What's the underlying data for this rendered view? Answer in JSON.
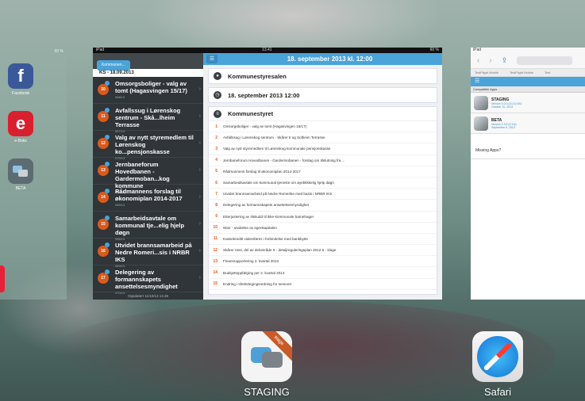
{
  "home_card": {
    "battery": "60 %",
    "apps": [
      {
        "label": "Facebook",
        "glyph": "f",
        "color": "#3b5998"
      },
      {
        "label": "e-Boks",
        "glyph": "e",
        "color": "#d9202e"
      },
      {
        "label": "BETA",
        "glyph": "",
        "color": "#5d6b72"
      }
    ]
  },
  "center_card": {
    "status": {
      "device": "iPad",
      "time": "13.41",
      "battery": "60 %"
    },
    "back_label": "Kommunen...",
    "section_header": "KS - 18.09.2013",
    "items": [
      {
        "num": "10",
        "title": "Omsorgsboliger - valg av tomt (Hagasvingen 15/17)",
        "date": "068/13"
      },
      {
        "num": "11",
        "title": "Avfallssug i Lørenskog sentrum - Skå...lheim Terrasse",
        "date": "067/13"
      },
      {
        "num": "12",
        "title": "Valg av nytt styremedlem til Lørenskog ko...pensjonskasse",
        "date": "079/13"
      },
      {
        "num": "13",
        "title": "Jernbaneforum Hovedbanen - Gardermoban...kog kommune",
        "date": "084/13"
      },
      {
        "num": "14",
        "title": "Rådmannens forslag til økonomiplan 2014-2017",
        "date": "085/13"
      },
      {
        "num": "15",
        "title": "Samarbeidsavtale om kommunal tje...elig hjelp døgn",
        "date": "086/13"
      },
      {
        "num": "16",
        "title": "Utvidet brannsamarbeid på Nedre Romeri...sis i NRBR IKS",
        "date": "069/13"
      },
      {
        "num": "17",
        "title": "Delegering av formannskapets ansettelsesmyndighet",
        "date": "070/13"
      }
    ],
    "footer": "Oppdatert 11/10/13 13.38",
    "header_title": "18. september 2013 kl. 12:00",
    "location": "Kommunestyresalen",
    "datetime": "18. september 2013 12:00",
    "list_title": "Kommunestyret",
    "agenda": [
      {
        "n": "1",
        "text": "Omsorgsboliger - valg av tomt (Hagasvingen 15/17)"
      },
      {
        "n": "2",
        "text": "Avfallssug i Lørenskog sentrum - Skårer II og Solheim Terrasse"
      },
      {
        "n": "3",
        "text": "Valg av nytt styremedlem til Lørenskog kommunale pensjonskasse"
      },
      {
        "n": "4",
        "text": "Jernbaneforum Hovedbanen - Gardermobanen - forslag om tilslutning fra ..."
      },
      {
        "n": "5",
        "text": "Rådmannens forslag til økonomiplan 2014-2017"
      },
      {
        "n": "6",
        "text": "Samarbeidsavtale om kommunal tjeneste om øyeblikkelig hjelp døgn"
      },
      {
        "n": "7",
        "text": "Utvidet brannsamarbeid på Nedre Romerike med basis i NRBR IKS"
      },
      {
        "n": "8",
        "text": "Delegering av formannskapets ansettelsesmyndighet"
      },
      {
        "n": "9",
        "text": "Etterjustering av tilskudd til ikke-kommunale barnehager"
      },
      {
        "n": "10",
        "text": "Nitor - utvidelse av egenkapitalen"
      },
      {
        "n": "11",
        "text": "Kassekreditt videreføres i forbindelse med bankbytte"
      },
      {
        "n": "12",
        "text": "Skårer Vest, del av delområde 9 - detaljreguleringsplan 2012-5 - klage"
      },
      {
        "n": "13",
        "text": "Finansrapportering 2. kvartal 2013"
      },
      {
        "n": "14",
        "text": "Budsjettoppfølging per 2. kvartal 2013"
      },
      {
        "n": "15",
        "text": "Endring i tilrettelegingsordning for seniorer"
      }
    ]
  },
  "right_card": {
    "device": "iPad",
    "tabs": [
      "TestFlight Mobile",
      "TestFlight Mobile",
      "Test"
    ],
    "section": "Compatible Apps",
    "apps": [
      {
        "name": "STAGING",
        "version": "Version 3.0.0 (3.0.0) 451",
        "date": "October 10, 2013"
      },
      {
        "name": "BETA",
        "version": "Version 2.3.6 (2.3.6)",
        "date": "September 6, 2013"
      }
    ],
    "missing": "Missing Apps?"
  },
  "dock": {
    "staging_label": "STAGING",
    "staging_ribbon": "stage",
    "safari_label": "Safari"
  }
}
